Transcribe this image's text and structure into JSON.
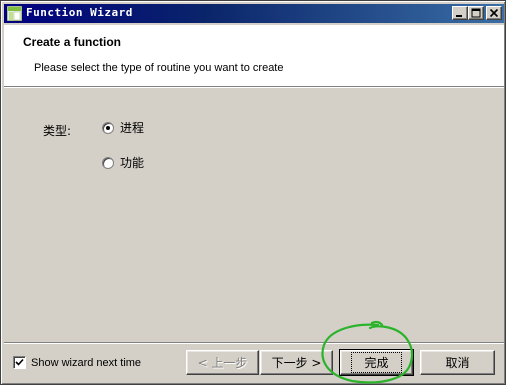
{
  "window": {
    "title": "Function Wizard",
    "controls": {
      "minimize": "minimize",
      "maximize": "maximize",
      "close": "close"
    }
  },
  "header": {
    "title": "Create a function",
    "subtitle": "Please select the type of routine you want to create"
  },
  "form": {
    "type_label": "类型:",
    "options": [
      {
        "label": "进程",
        "selected": true
      },
      {
        "label": "功能",
        "selected": false
      }
    ]
  },
  "footer": {
    "show_wizard_label": "Show wizard next time",
    "show_wizard_checked": true,
    "buttons": {
      "prev": "< 上一步",
      "next": "下一步 >",
      "finish": "完成",
      "cancel": "取消"
    }
  },
  "colors": {
    "titlebar": "#0a246a",
    "face": "#d4d0c8",
    "annotation": "#2bb32b"
  }
}
